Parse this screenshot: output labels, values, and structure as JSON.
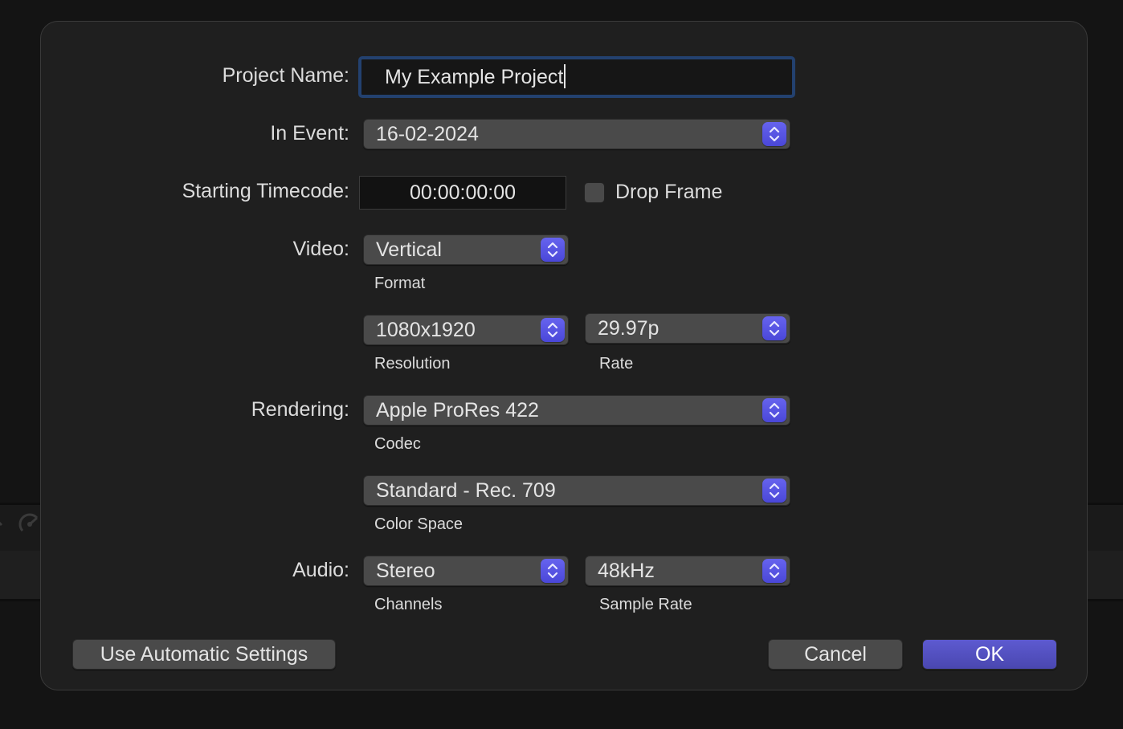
{
  "dialog": {
    "project_name": {
      "label": "Project Name:",
      "value": "My Example Project"
    },
    "in_event": {
      "label": "In Event:",
      "value": "16-02-2024"
    },
    "starting_timecode": {
      "label": "Starting Timecode:",
      "value": "00:00:00:00",
      "drop_frame": {
        "label": "Drop Frame",
        "checked": false
      }
    },
    "video": {
      "label": "Video:",
      "format": {
        "value": "Vertical",
        "caption": "Format"
      },
      "resolution": {
        "value": "1080x1920",
        "caption": "Resolution"
      },
      "rate": {
        "value": "29.97p",
        "caption": "Rate"
      }
    },
    "rendering": {
      "label": "Rendering:",
      "codec": {
        "value": "Apple ProRes 422",
        "caption": "Codec"
      },
      "color_space": {
        "value": "Standard - Rec. 709",
        "caption": "Color Space"
      }
    },
    "audio": {
      "label": "Audio:",
      "channels": {
        "value": "Stereo",
        "caption": "Channels"
      },
      "sample_rate": {
        "value": "48kHz",
        "caption": "Sample Rate"
      }
    },
    "buttons": {
      "automatic": "Use Automatic Settings",
      "cancel": "Cancel",
      "ok": "OK"
    }
  },
  "colors": {
    "accent": "#5653e0",
    "focus_ring": "#23416f",
    "dialog_bg": "#1f1f1f"
  }
}
